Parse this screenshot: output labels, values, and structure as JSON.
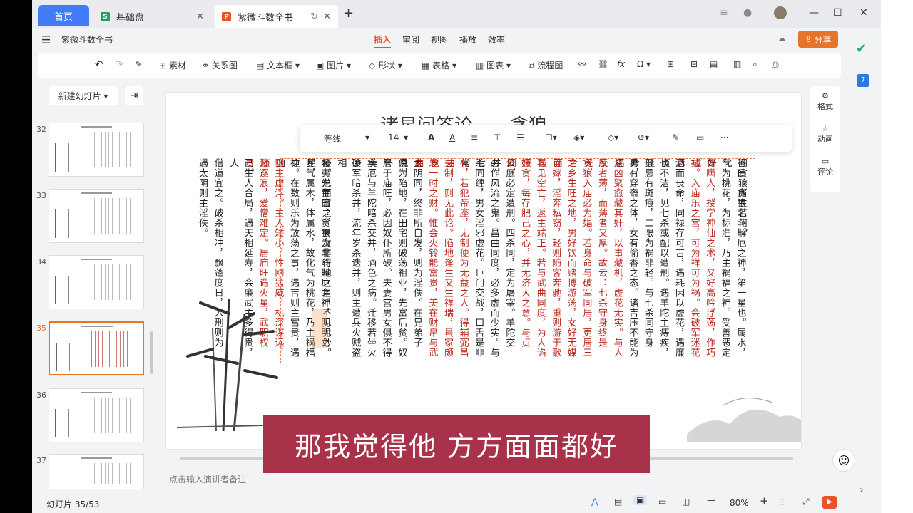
{
  "tabs": {
    "home": "首页",
    "tab1": "基础盘",
    "tab2": "紫微斗数全书"
  },
  "doc_title": "紫微斗数全书",
  "menus": [
    "插入",
    "审阅",
    "视图",
    "播放",
    "效率"
  ],
  "share": "分享",
  "toolbar": [
    "素材",
    "关系图",
    "文本框",
    "图片",
    "形状",
    "表格",
    "图表",
    "流程图"
  ],
  "left": {
    "new_slide": "新建幻灯片",
    "nums": [
      "32",
      "33",
      "34",
      "35",
      "36",
      "37"
    ]
  },
  "slide": {
    "title": "诸星问答论——贪狼",
    "columns": [
      "问贪狼所主若何？",
      "答曰：贪狼北斗解厄之神，第一星也。属水，化",
      "气为桃花，为标准，乃主祸福之神。受善恶定好",
      "诈瞒人，授学神仙之术，又好高吟浮荡，作巧成",
      "拙。入庙乐之宫，可为祥可为祸。会破军迷花恋",
      "酒而丧命，同禄存可吉，遇耗因以虚花，遇廉贞",
      "也不洁，见七杀或配以遭刑。遇羊陀主痔疾，逢",
      "刑忌有斑痕，二限为祸非轻。与七杀同守身命，",
      "男有穿窬之体，女有偷香之态。诸吉压不能为福",
      "众凶聚愈藏其奸，以事藏机，虚花无实。与人交",
      "厚者薄，而薄者又厚。故云：七杀守身终是夭，",
      "贪狼入庙必为娼。若身命与破军同居，更居三合",
      "之乡生旺之地，男好饮而赌博游荡，女好无媒而",
      "自嫁，淫奔私窃，轻则随客奔驰，重则游于歌妓",
      "喜见空亡，返主端正。若与武曲同度，为人谄佞",
      "奸贪，每存肥己之心，并无济人之意。与贞同，",
      "公庭必定遭刑。四杀同，定为屠宰。羊陀交并，",
      "必作风流之鬼。昌曲同度，必多虚而少实。与七",
      "杀同缠，男女淫邪虚花。巨门交战，口舌是非常",
      "有，若犯帝座，无制便为无益之人。得辅弼昌曲",
      "夹制，则无此论。陷地逢生又生祥瑞，虽家颇也",
      "发一时之财。惟会火铃能富贵，美在财帛与武曲",
      "太阴同，终非所自发，则为淫佚。在兄弟子息，",
      "俱为陷地，在田宅则破荡祖业，先富后贫。奴仆",
      "居于庙旺，必因奴仆所破。夫妻宫男女俱不得美",
      "疾厄与羊陀暗杀交并，酒色之病。迁移若坐火乡",
      "破军暗杀并，流年岁杀迭并，则主遭兵火贼盗相",
      "侵。总而言之，男女非得地之星，不见尤妙。",
      "希夷先生曰：贪狼为北斗解厄之神，阴明之星，",
      "其气属木，体属水，故化气为桃花，乃主祸福之",
      "神。在数则乐为放荡之事，遇吉则主富贵，遇凶",
      "则主虚浮。主人矮小，性刚猛威，机深谋远，随",
      "波逐浪，爱憎难定。居庙旺遇火星，武职权贵。",
      "己生人合局，遇天相延寿，会廉武主多得贵，人",
      "僧道宜之。破杀相冲，飘蓬度日，入刑则为",
      "遇太阴则主淫佚。"
    ],
    "red_cols": [
      3,
      4,
      9,
      10,
      11,
      12,
      13,
      14,
      15,
      19,
      20,
      21,
      31,
      32
    ]
  },
  "float_toolbar": {
    "font": "等线",
    "size": "14"
  },
  "subtitle": "那我觉得他  方方面面都好",
  "right_panel": [
    "格式",
    "动画",
    "评论"
  ],
  "notes_placeholder": "点击输入演讲者备注",
  "status": {
    "slide": "幻灯片 35/53",
    "zoom": "80%"
  }
}
